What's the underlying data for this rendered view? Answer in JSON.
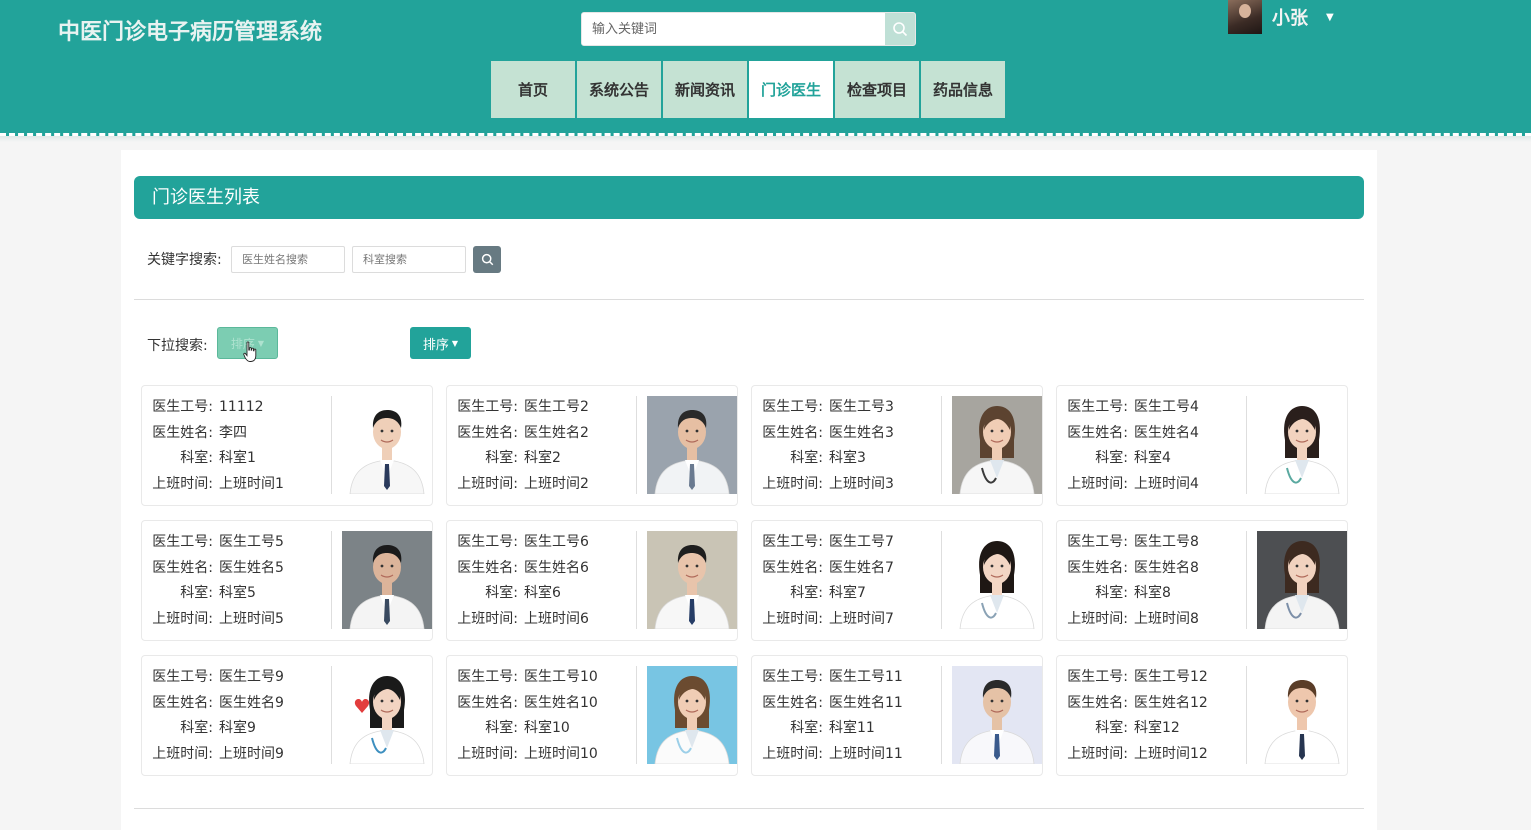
{
  "header": {
    "site_title": "中医门诊电子病历管理系统",
    "search_placeholder": "输入关键词",
    "user_name": "小张"
  },
  "nav": {
    "items": [
      {
        "label": "首页",
        "active": false
      },
      {
        "label": "系统公告",
        "active": false
      },
      {
        "label": "新闻资讯",
        "active": false
      },
      {
        "label": "门诊医生",
        "active": true
      },
      {
        "label": "检查项目",
        "active": false
      },
      {
        "label": "药品信息",
        "active": false
      }
    ]
  },
  "main": {
    "list_title": "门诊医生列表",
    "keyword_label": "关键字搜索:",
    "name_placeholder": "医生姓名搜索",
    "dept_placeholder": "科室搜索",
    "dropdown_label": "下拉搜索:",
    "dropdown_button": "排序",
    "sort_button": "排序"
  },
  "card_labels": {
    "id": "医生工号:",
    "name": "医生姓名:",
    "dept": "科室:",
    "time": "上班时间:"
  },
  "doctors": [
    {
      "id": "11112",
      "name": "李四",
      "dept": "科室1",
      "time": "上班时间1",
      "photo": {
        "bg": "#ffffff",
        "hair": "#1c1c1c",
        "skin": "#efcfb8",
        "coat": "#f7f7f7",
        "tie": "#2a3a5c",
        "gender": "m"
      }
    },
    {
      "id": "医生工号2",
      "name": "医生姓名2",
      "dept": "科室2",
      "time": "上班时间2",
      "photo": {
        "bg": "#9aa3ad",
        "hair": "#2a2a2a",
        "skin": "#e6bfa3",
        "coat": "#f1f3f5",
        "tie": "#6a7a90",
        "gender": "m"
      }
    },
    {
      "id": "医生工号3",
      "name": "医生姓名3",
      "dept": "科室3",
      "time": "上班时间3",
      "photo": {
        "bg": "#a7a59f",
        "hair": "#5c4330",
        "skin": "#f0cdb5",
        "coat": "#f6f6f6",
        "tie": "#3a3a3a",
        "gender": "f"
      }
    },
    {
      "id": "医生工号4",
      "name": "医生姓名4",
      "dept": "科室4",
      "time": "上班时间4",
      "photo": {
        "bg": "#ffffff",
        "hair": "#2a1f1c",
        "skin": "#f2d3bf",
        "coat": "#ffffff",
        "tie": "#5aa9a0",
        "gender": "f"
      }
    },
    {
      "id": "医生工号5",
      "name": "医生姓名5",
      "dept": "科室5",
      "time": "上班时间5",
      "photo": {
        "bg": "#7c8387",
        "hair": "#1b1b1b",
        "skin": "#dcb49a",
        "coat": "#f4f4f4",
        "tie": "#394a60",
        "gender": "m"
      }
    },
    {
      "id": "医生工号6",
      "name": "医生姓名6",
      "dept": "科室6",
      "time": "上班时间6",
      "photo": {
        "bg": "#c9c4b5",
        "hair": "#1e1e1e",
        "skin": "#e8c4ab",
        "coat": "#f7f7f7",
        "tie": "#263d66",
        "gender": "m"
      }
    },
    {
      "id": "医生工号7",
      "name": "医生姓名7",
      "dept": "科室7",
      "time": "上班时间7",
      "photo": {
        "bg": "#ffffff",
        "hair": "#1e1714",
        "skin": "#f3d6c4",
        "coat": "#ffffff",
        "tie": "#8aa2b5",
        "gender": "f"
      }
    },
    {
      "id": "医生工号8",
      "name": "医生姓名8",
      "dept": "科室8",
      "time": "上班时间8",
      "photo": {
        "bg": "#4d4f52",
        "hair": "#3d2a20",
        "skin": "#f1d2bf",
        "coat": "#f4f4f4",
        "tie": "#7c8fa8",
        "gender": "f"
      }
    },
    {
      "id": "医生工号9",
      "name": "医生姓名9",
      "dept": "科室9",
      "time": "上班时间9",
      "photo": {
        "bg": "#ffffff",
        "hair": "#1a1a1a",
        "skin": "#f2d4c2",
        "coat": "#ffffff",
        "tie": "#3d8fbf",
        "gender": "f",
        "heart": "#e23d3d"
      }
    },
    {
      "id": "医生工号10",
      "name": "医生姓名10",
      "dept": "科室10",
      "time": "上班时间10",
      "photo": {
        "bg": "#78c5e3",
        "hair": "#6b4b30",
        "skin": "#f0cdb5",
        "coat": "#fbfbfb",
        "tie": "#9ccfe8",
        "gender": "f"
      }
    },
    {
      "id": "医生工号11",
      "name": "医生姓名11",
      "dept": "科室11",
      "time": "上班时间11",
      "photo": {
        "bg": "#e3e6f3",
        "hair": "#2a2a2a",
        "skin": "#e5c2a6",
        "coat": "#f8f8fb",
        "tie": "#3a5a8c",
        "gender": "m"
      }
    },
    {
      "id": "医生工号12",
      "name": "医生姓名12",
      "dept": "科室12",
      "time": "上班时间12",
      "photo": {
        "bg": "#ffffff",
        "hair": "#5a3d28",
        "skin": "#eec7ad",
        "coat": "#ffffff",
        "tie": "#263550",
        "gender": "m"
      }
    }
  ]
}
